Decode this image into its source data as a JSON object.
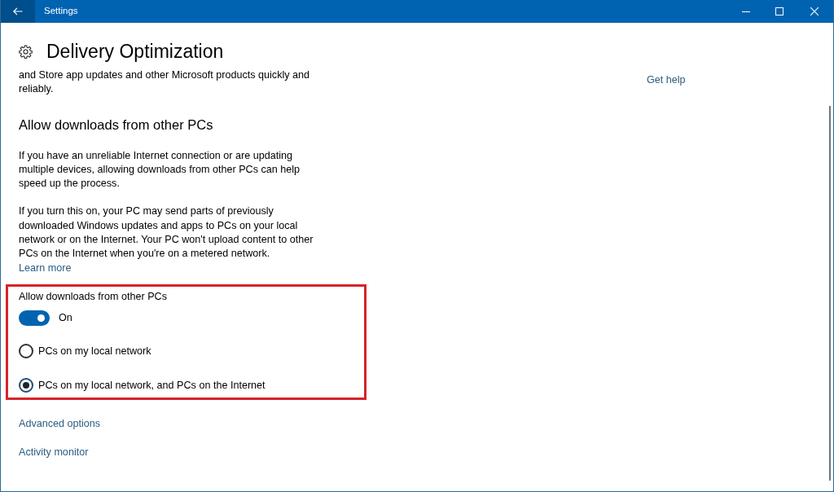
{
  "window": {
    "title": "Settings"
  },
  "page": {
    "title": "Delivery Optimization",
    "intro": "and Store app updates and other Microsoft products quickly and reliably.",
    "help_link": "Get help"
  },
  "section": {
    "title": "Allow downloads from other PCs",
    "paragraphs": [
      "If you have an unreliable Internet connection or are updating multiple devices, allowing downloads from other PCs can help speed up the process.",
      "If you turn this on, your PC may send parts of previously downloaded Windows updates and apps to PCs on your local network or on the Internet. Your PC won't upload content to other PCs on the Internet when you're on a metered network."
    ],
    "learn_more": "Learn more"
  },
  "setting": {
    "highlighted": true,
    "label": "Allow downloads from other PCs",
    "toggle": {
      "on": true,
      "state_label": "On"
    },
    "options": [
      {
        "label": "PCs on my local network",
        "selected": false
      },
      {
        "label": "PCs on my local network, and PCs on the Internet",
        "selected": true
      }
    ]
  },
  "links": [
    "Advanced options",
    "Activity monitor"
  ]
}
